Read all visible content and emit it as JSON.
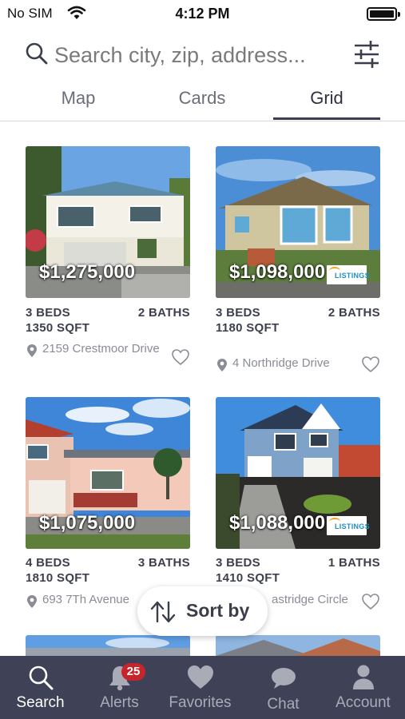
{
  "status_bar": {
    "carrier": "No SIM",
    "time": "4:12 PM",
    "battery": "full"
  },
  "search": {
    "placeholder": "Search city, zip, address..."
  },
  "tabs": [
    {
      "label": "Map",
      "active": false
    },
    {
      "label": "Cards",
      "active": false
    },
    {
      "label": "Grid",
      "active": true
    }
  ],
  "listings": [
    {
      "price": "$1,275,000",
      "beds": "3 BEDS",
      "baths": "2 BATHS",
      "sqft": "1350 SQFT",
      "address": "2159 Crestmoor Drive",
      "logo": false
    },
    {
      "price": "$1,098,000",
      "beds": "3 BEDS",
      "baths": "2 BATHS",
      "sqft": "1180 SQFT",
      "address": "4 Northridge Drive",
      "logo": true,
      "logo_text": "LISTINGS"
    },
    {
      "price": "$1,075,000",
      "beds": "4 BEDS",
      "baths": "3 BATHS",
      "sqft": "1810 SQFT",
      "address": "693 7Th Avenue",
      "logo": false
    },
    {
      "price": "$1,088,000",
      "beds": "3 BEDS",
      "baths": "1 BATHS",
      "sqft": "1410 SQFT",
      "address": "astridge Circle",
      "logo": true,
      "logo_text": "LISTINGS"
    }
  ],
  "sort": {
    "label": "Sort by"
  },
  "bottom_nav": [
    {
      "label": "Search",
      "icon": "search-icon",
      "active": true
    },
    {
      "label": "Alerts",
      "icon": "bell-icon",
      "badge": "25",
      "active": false
    },
    {
      "label": "Favorites",
      "icon": "heart-icon",
      "active": false
    },
    {
      "label": "Chat",
      "icon": "chat-bubble-icon",
      "active": false
    },
    {
      "label": "Account",
      "icon": "person-icon",
      "active": false
    }
  ],
  "colors": {
    "nav_background": "#3f4257",
    "active_tab_underline": "#3a3d55",
    "badge": "#c8242c"
  }
}
